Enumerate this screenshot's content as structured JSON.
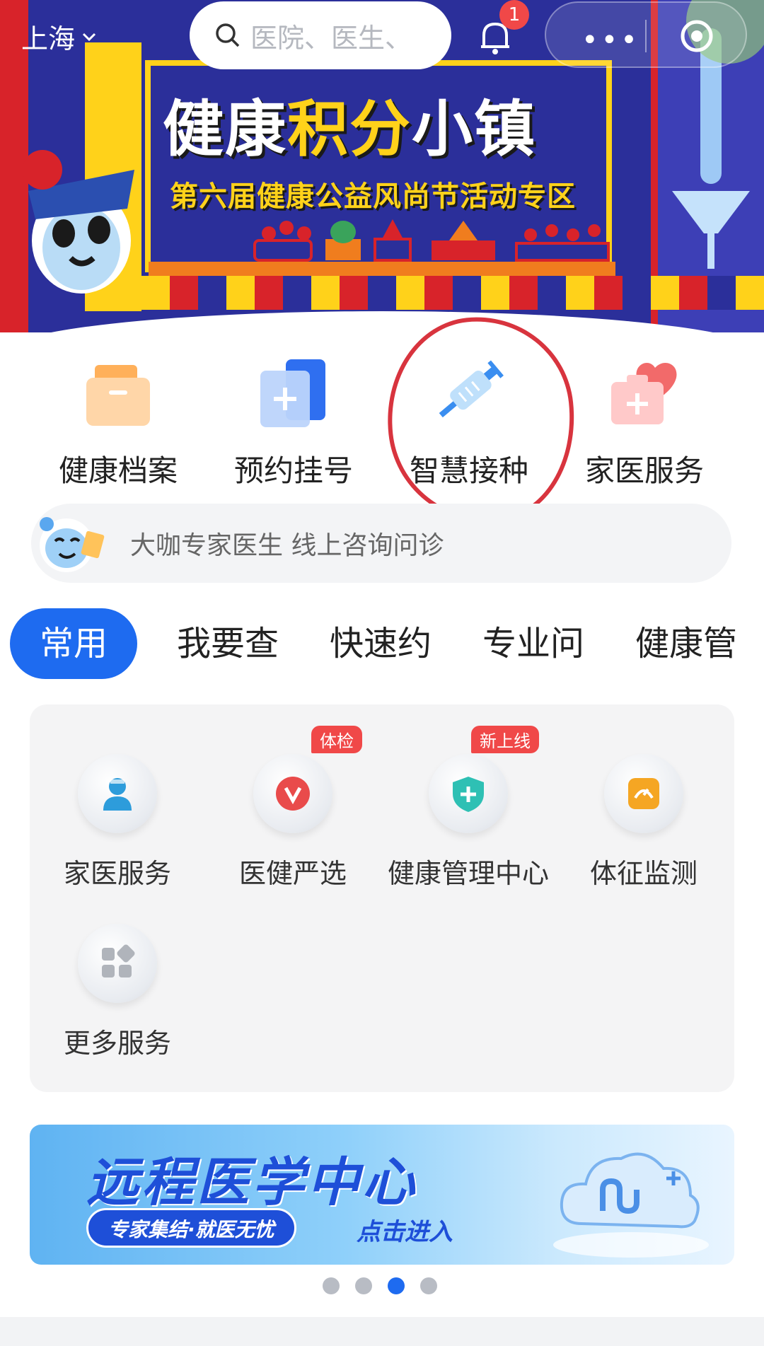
{
  "header": {
    "city": "上海",
    "search_placeholder": "医院、医生、",
    "notification_count": "1"
  },
  "banner": {
    "title_part1": "健康",
    "title_part2": "积分",
    "title_part3": "小镇",
    "subtitle": "第六届健康公益风尚节活动专区"
  },
  "quick_entries": [
    {
      "label": "健康档案",
      "icon": "folder-icon"
    },
    {
      "label": "预约挂号",
      "icon": "add-card-icon"
    },
    {
      "label": "智慧接种",
      "icon": "syringe-icon"
    },
    {
      "label": "家医服务",
      "icon": "medical-kit-heart-icon"
    }
  ],
  "consult": {
    "text": "大咖专家医生 线上咨询问诊"
  },
  "tabs": [
    {
      "label": "常用",
      "active": true
    },
    {
      "label": "我要查",
      "active": false
    },
    {
      "label": "快速约",
      "active": false
    },
    {
      "label": "专业问",
      "active": false
    },
    {
      "label": "健康管",
      "active": false
    }
  ],
  "services": [
    {
      "label": "家医服务",
      "icon": "doctor-icon",
      "tag": ""
    },
    {
      "label": "医健严选",
      "icon": "badge-v-icon",
      "tag": "体检"
    },
    {
      "label": "健康管理中心",
      "icon": "shield-plus-icon",
      "tag": "新上线"
    },
    {
      "label": "体征监测",
      "icon": "gauge-icon",
      "tag": ""
    },
    {
      "label": "更多服务",
      "icon": "grid-icon",
      "tag": ""
    }
  ],
  "tele_banner": {
    "title": "远程医学中心",
    "slogan": "专家集结·就医无忧",
    "cta": "点击进入"
  },
  "pager": {
    "total": 4,
    "current": 3
  },
  "colors": {
    "primary": "#1e6bf0",
    "badge_red": "#f04848",
    "annotation_red": "#d8343e"
  }
}
